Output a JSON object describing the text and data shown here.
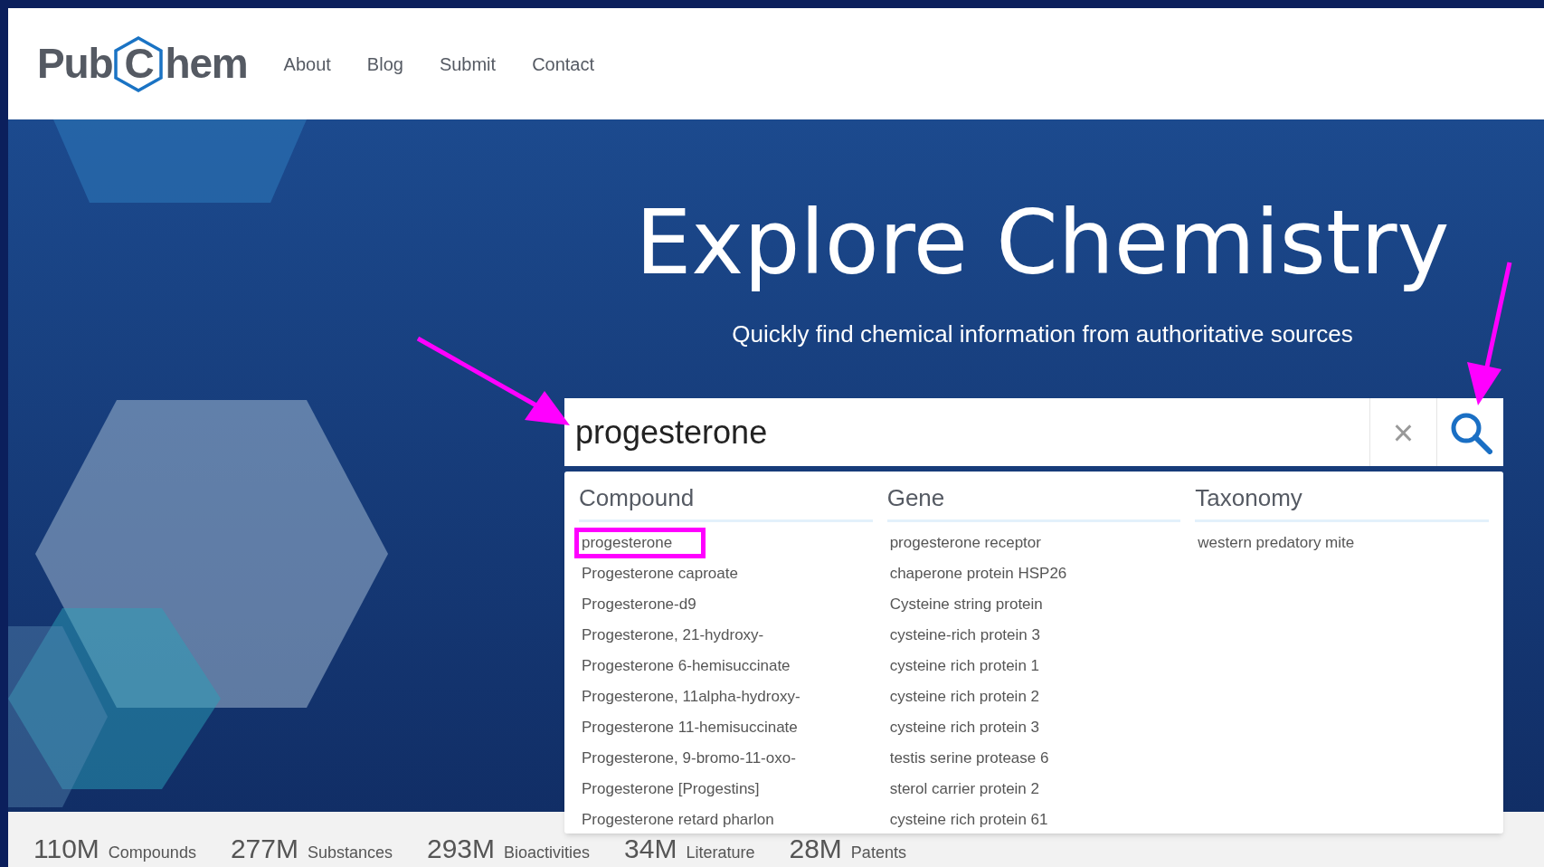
{
  "header": {
    "logo": {
      "before": "Pub",
      "letter": "C",
      "after": "hem"
    },
    "nav": [
      "About",
      "Blog",
      "Submit",
      "Contact"
    ]
  },
  "hero": {
    "title": "Explore Chemistry",
    "subtitle": "Quickly find chemical information from authoritative sources"
  },
  "search": {
    "value": "progesterone",
    "clear": "×"
  },
  "suggestions": [
    {
      "heading": "Compound",
      "items": [
        {
          "label": "progesterone",
          "selected": true
        },
        {
          "label": "Progesterone caproate",
          "selected": false
        },
        {
          "label": "Progesterone-d9",
          "selected": false
        },
        {
          "label": "Progesterone, 21-hydroxy-",
          "selected": false
        },
        {
          "label": "Progesterone 6-hemisuccinate",
          "selected": false
        },
        {
          "label": "Progesterone, 11alpha-hydroxy-",
          "selected": false
        },
        {
          "label": "Progesterone 11-hemisuccinate",
          "selected": false
        },
        {
          "label": "Progesterone, 9-bromo-11-oxo-",
          "selected": false
        },
        {
          "label": "Progesterone [Progestins]",
          "selected": false
        },
        {
          "label": "Progesterone retard pharlon",
          "selected": false
        }
      ]
    },
    {
      "heading": "Gene",
      "items": [
        {
          "label": "progesterone receptor",
          "selected": false
        },
        {
          "label": "chaperone protein HSP26",
          "selected": false
        },
        {
          "label": "Cysteine string protein",
          "selected": false
        },
        {
          "label": "cysteine-rich protein 3",
          "selected": false
        },
        {
          "label": "cysteine rich protein 1",
          "selected": false
        },
        {
          "label": "cysteine rich protein 2",
          "selected": false
        },
        {
          "label": "cysteine rich protein 3",
          "selected": false
        },
        {
          "label": "testis serine protease 6",
          "selected": false
        },
        {
          "label": "sterol carrier protein 2",
          "selected": false
        },
        {
          "label": "cysteine rich protein 61",
          "selected": false
        }
      ]
    },
    {
      "heading": "Taxonomy",
      "items": [
        {
          "label": "western predatory mite",
          "selected": false
        }
      ]
    }
  ],
  "stats": [
    {
      "value": "110M",
      "label": "Compounds"
    },
    {
      "value": "277M",
      "label": "Substances"
    },
    {
      "value": "293M",
      "label": "Bioactivities"
    },
    {
      "value": "34M",
      "label": "Literature"
    },
    {
      "value": "28M",
      "label": "Patents"
    }
  ]
}
